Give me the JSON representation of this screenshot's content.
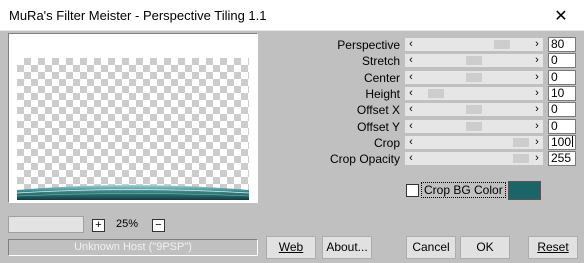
{
  "window": {
    "title": "MuRa's Filter Meister - Perspective Tiling 1.1",
    "close_glyph": "✕"
  },
  "preview": {
    "zoom": "25%",
    "zoom_in": "+",
    "zoom_out": "−",
    "status": "Unknown Host (\"9PSP\")"
  },
  "params": [
    {
      "label": "Perspective",
      "value": "80",
      "slider_fraction": 0.8
    },
    {
      "label": "Stretch",
      "value": "0",
      "slider_fraction": 0.5
    },
    {
      "label": "Center",
      "value": "0",
      "slider_fraction": 0.5
    },
    {
      "label": "Height",
      "value": "10",
      "slider_fraction": 0.1
    },
    {
      "label": "Offset X",
      "value": "0",
      "slider_fraction": 0.5
    },
    {
      "label": "Offset Y",
      "value": "0",
      "slider_fraction": 0.5
    },
    {
      "label": "Crop",
      "value": "100",
      "slider_fraction": 1.0
    },
    {
      "label": "Crop Opacity",
      "value": "255",
      "slider_fraction": 1.0
    }
  ],
  "crop_bg": {
    "label": "Crop BG Color",
    "checked": false,
    "color": "#1b6468"
  },
  "buttons": {
    "web": "Web",
    "about": "About...",
    "cancel": "Cancel",
    "ok": "OK",
    "reset": "Reset"
  },
  "icons": {
    "slider_left": "chevron-left-icon",
    "slider_right": "chevron-right-icon",
    "close": "close-icon"
  }
}
